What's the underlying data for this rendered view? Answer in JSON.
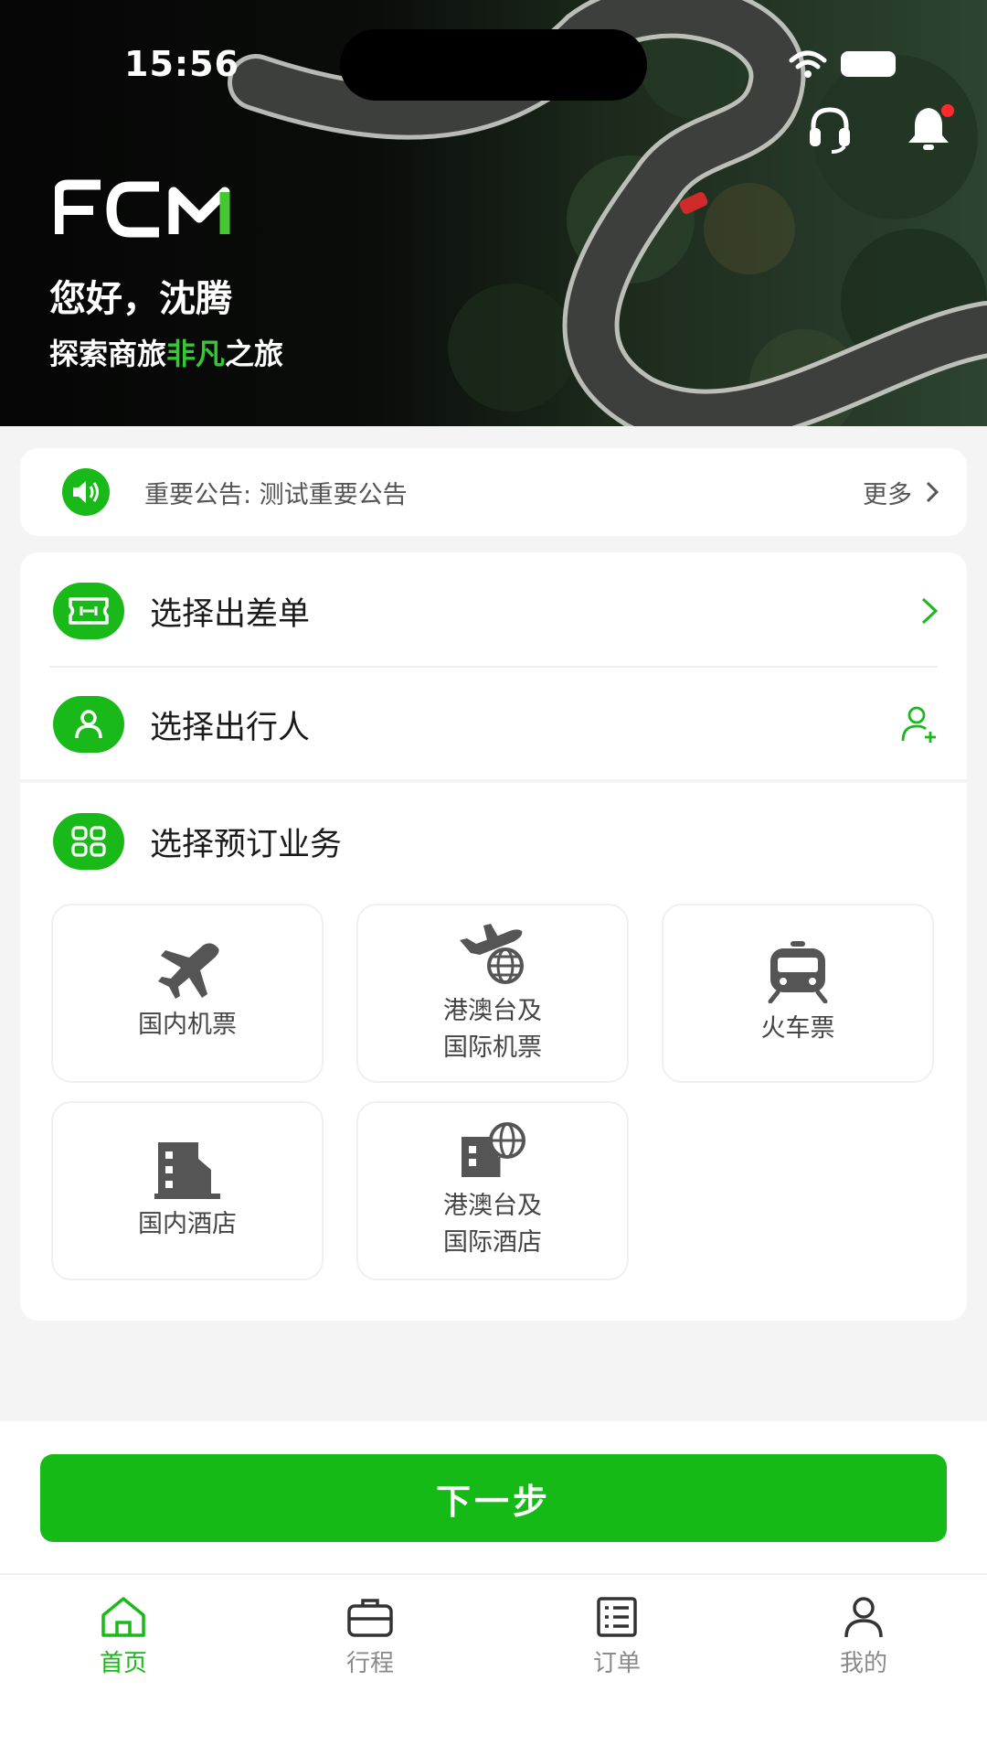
{
  "status_bar": {
    "time": "15:56"
  },
  "hero": {
    "brand": "FCM",
    "greeting": "您好，沈腾",
    "slogan_prefix": "探索商旅",
    "slogan_highlight": "非凡",
    "slogan_suffix": "之旅"
  },
  "notice": {
    "text": "重要公告: 测试重要公告",
    "more_label": "更多"
  },
  "rows": {
    "trip_order": "选择出差单",
    "traveler": "选择出行人",
    "booking": "选择预订业务"
  },
  "services": [
    {
      "line1": "国内机票",
      "line2": "",
      "icon": "airplane-icon"
    },
    {
      "line1": "港澳台及",
      "line2": "国际机票",
      "icon": "international-flight-icon"
    },
    {
      "line1": "火车票",
      "line2": "",
      "icon": "train-icon"
    },
    {
      "line1": "国内酒店",
      "line2": "",
      "icon": "hotel-icon"
    },
    {
      "line1": "港澳台及",
      "line2": "国际酒店",
      "icon": "international-hotel-icon"
    }
  ],
  "next_button": "下一步",
  "tabs": [
    {
      "label": "首页",
      "icon": "home-icon",
      "active": true
    },
    {
      "label": "行程",
      "icon": "briefcase-icon",
      "active": false
    },
    {
      "label": "订单",
      "icon": "list-icon",
      "active": false
    },
    {
      "label": "我的",
      "icon": "user-icon",
      "active": false
    }
  ],
  "colors": {
    "brand_green": "#18b918",
    "notification_dot": "#ff2a2a",
    "background": "#f4f4f4"
  }
}
